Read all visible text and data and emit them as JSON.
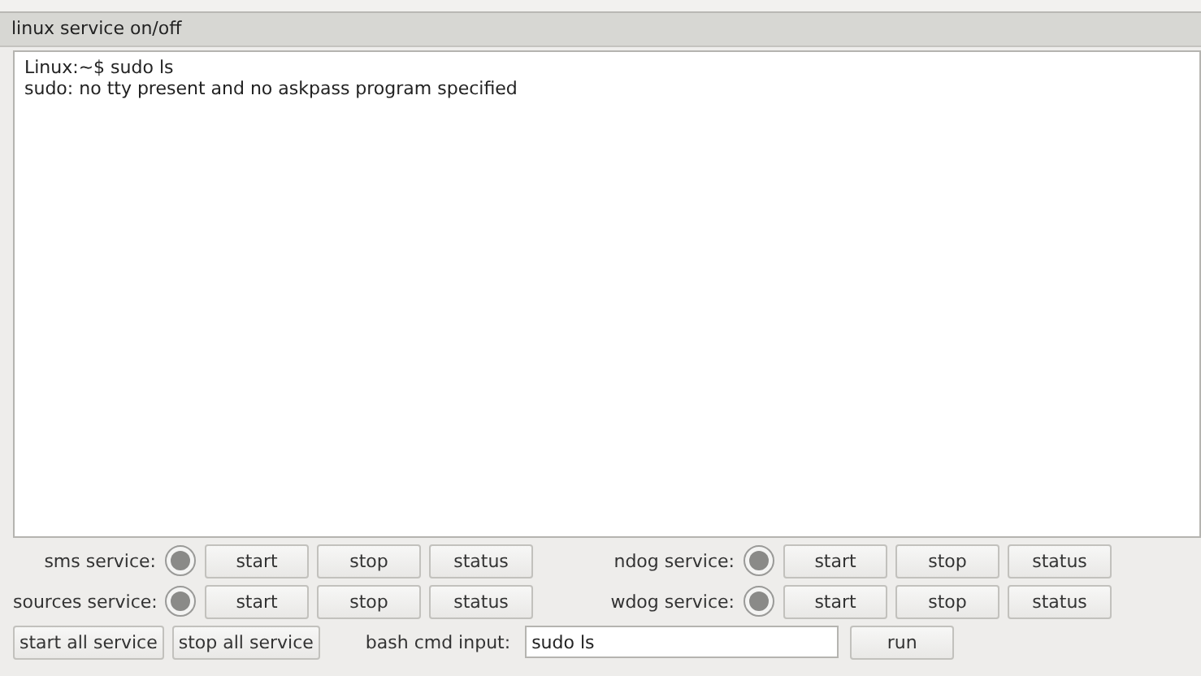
{
  "title": "linux service on/off",
  "console": [
    "Linux:~$ sudo ls",
    "sudo: no tty present and no askpass program specified"
  ],
  "services": [
    {
      "label": "sms service:",
      "on": false,
      "buttons": [
        "start",
        "stop",
        "status"
      ]
    },
    {
      "label": "ndog service:",
      "on": false,
      "buttons": [
        "start",
        "stop",
        "status"
      ]
    },
    {
      "label": "sources service:",
      "on": false,
      "buttons": [
        "start",
        "stop",
        "status"
      ]
    },
    {
      "label": "wdog service:",
      "on": false,
      "buttons": [
        "start",
        "stop",
        "status"
      ]
    }
  ],
  "start_all": "start all service",
  "stop_all": "stop all service",
  "cmd": {
    "label": "bash cmd input:",
    "value": "sudo ls"
  },
  "run": "run"
}
